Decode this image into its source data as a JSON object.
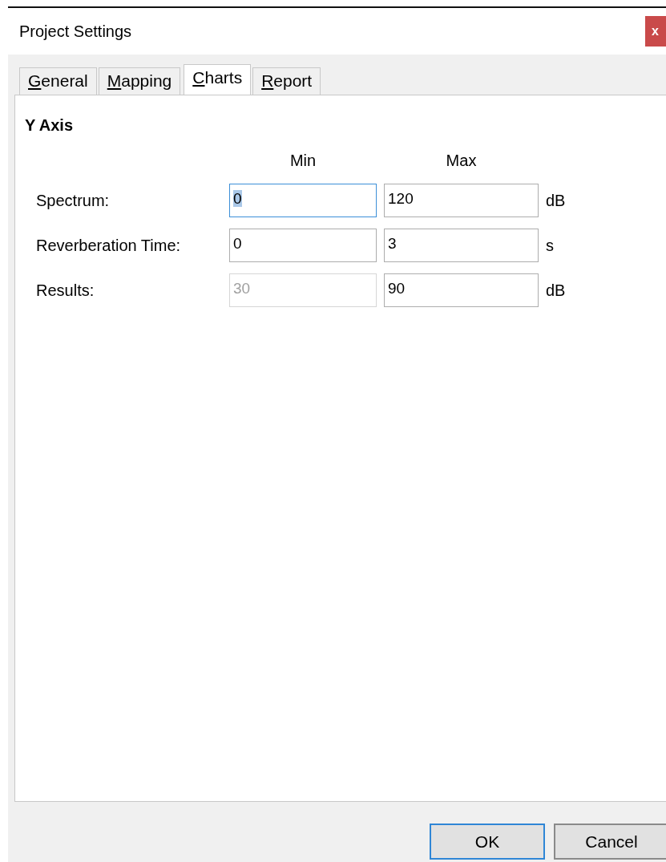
{
  "window": {
    "title": "Project Settings",
    "close": "x"
  },
  "tabs": [
    {
      "label": "General",
      "selected": false
    },
    {
      "label": "Mapping",
      "selected": false
    },
    {
      "label": "Charts",
      "selected": true
    },
    {
      "label": "Report",
      "selected": false
    }
  ],
  "section": {
    "title": "Y Axis",
    "columns": [
      "Min",
      "Max"
    ],
    "rows": [
      {
        "label": "Spectrum:",
        "min": {
          "value": "0",
          "focused": true,
          "disabled": false
        },
        "max": {
          "value": "120",
          "focused": false,
          "disabled": false
        },
        "unit": "dB"
      },
      {
        "label": "Reverberation Time:",
        "min": {
          "value": "0",
          "focused": false,
          "disabled": false
        },
        "max": {
          "value": "3",
          "focused": false,
          "disabled": false
        },
        "unit": "s"
      },
      {
        "label": "Results:",
        "min": {
          "value": "30",
          "focused": false,
          "disabled": true
        },
        "max": {
          "value": "90",
          "focused": false,
          "disabled": false
        },
        "unit": "dB"
      }
    ]
  },
  "buttons": [
    {
      "label": "OK",
      "default": true
    },
    {
      "label": "Cancel",
      "default": false
    }
  ]
}
